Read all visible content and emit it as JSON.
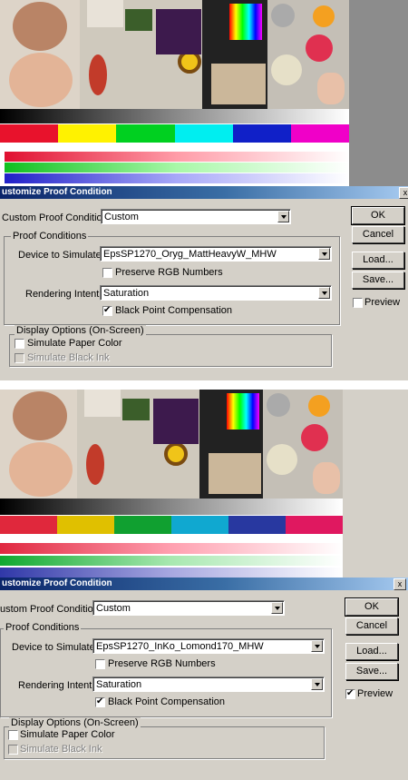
{
  "colors": {
    "title_start": "#0a246a",
    "title_end": "#a6caf0",
    "face": "#d4d0c8"
  },
  "dialog1": {
    "title": "ustomize Proof Condition",
    "custom_label": "Custom Proof Condition:",
    "custom_value": "Custom",
    "proof_group": "Proof Conditions",
    "device_label": "Device to Simulate:",
    "device_value": "EpsSP1270_Oryg_MattHeavyW_MHW",
    "preserve_label": "Preserve RGB Numbers",
    "rendering_label": "Rendering Intent:",
    "rendering_value": "Saturation",
    "bpc_label": "Black Point Compensation",
    "display_group": "Display Options (On-Screen)",
    "paper_label": "Simulate Paper Color",
    "ink_label": "Simulate Black Ink",
    "ok": "OK",
    "cancel": "Cancel",
    "load": "Load...",
    "save": "Save...",
    "preview": "Preview",
    "preview_checked": false,
    "bpc_checked": true,
    "preserve_checked": false,
    "paper_checked": false
  },
  "dialog2": {
    "title": "ustomize Proof Condition",
    "custom_label": "ustom Proof Condition:",
    "custom_value": "Custom",
    "proof_group": "Proof Conditions",
    "device_label": "Device to Simulate:",
    "device_value": "EpsSP1270_InKo_Lomond170_MHW",
    "preserve_label": "Preserve RGB Numbers",
    "rendering_label": "Rendering Intent:",
    "rendering_value": "Saturation",
    "bpc_label": "Black Point Compensation",
    "display_group": "Display Options (On-Screen)",
    "paper_label": "Simulate Paper Color",
    "ink_label": "Simulate Black Ink",
    "ok": "OK",
    "cancel": "Cancel",
    "load": "Load...",
    "save": "Save...",
    "preview": "Preview",
    "preview_checked": true,
    "bpc_checked": true,
    "preserve_checked": false,
    "paper_checked": false
  },
  "close_glyph": "x"
}
